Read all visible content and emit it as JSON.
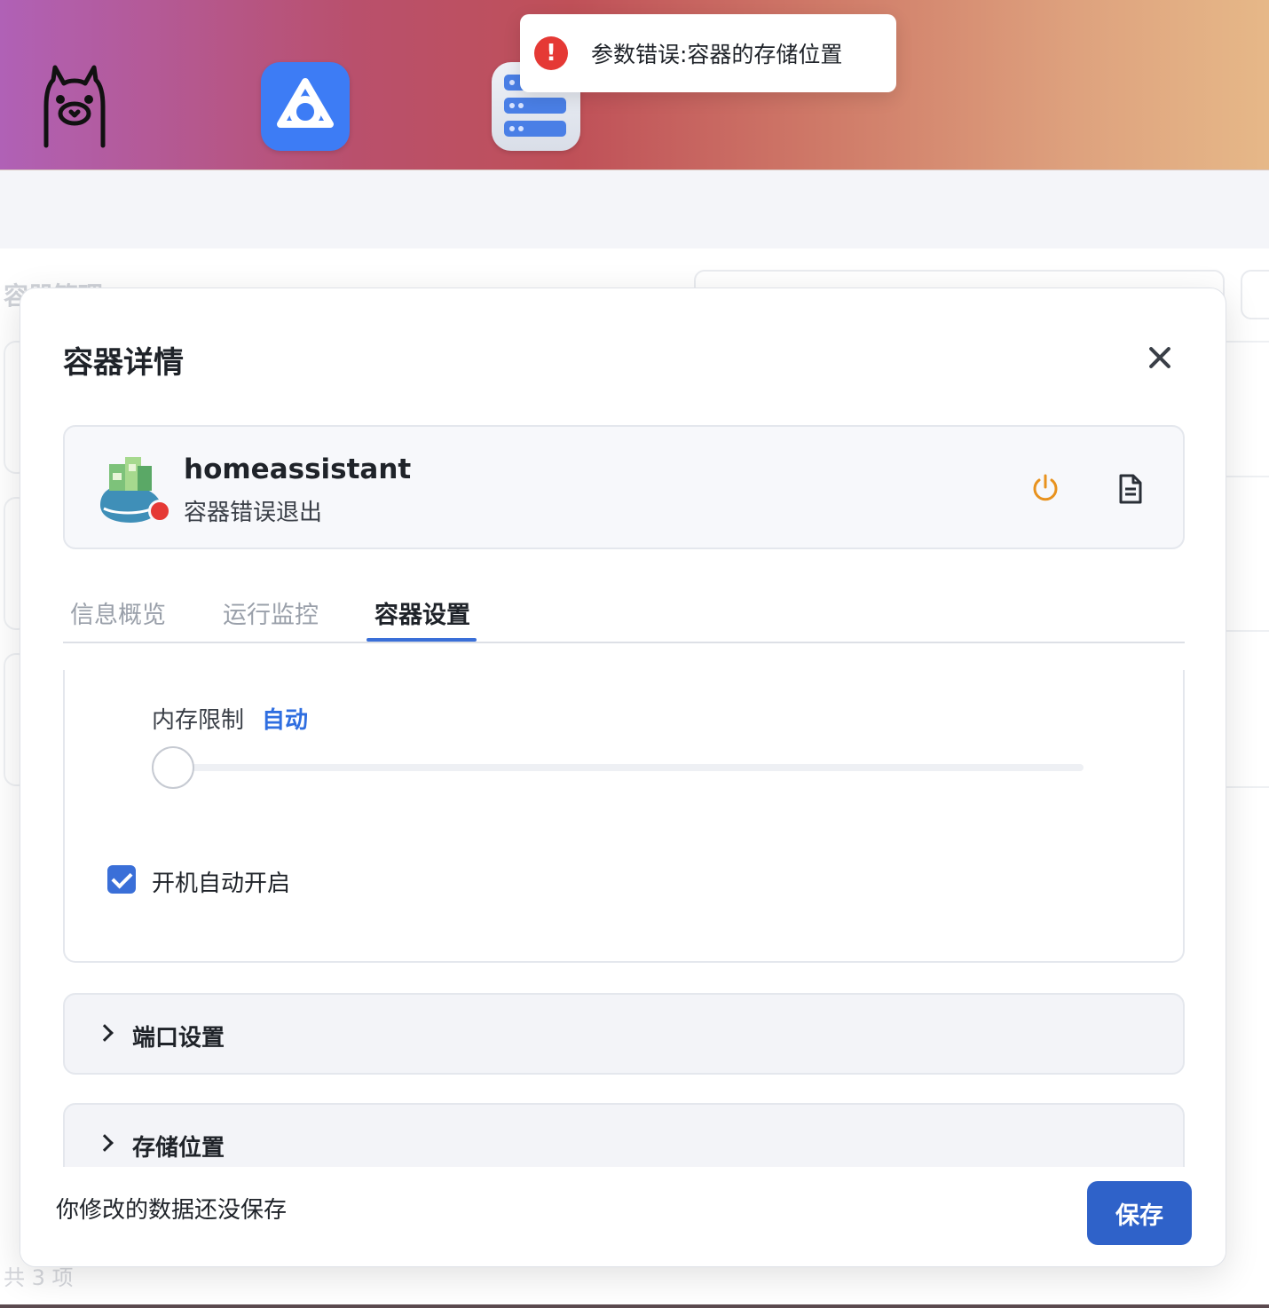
{
  "toast": {
    "icon": "error-exclamation-icon",
    "message": "参数错误:容器的存储位置",
    "color": "#e53935"
  },
  "dock": {
    "items": [
      "llama-app-icon",
      "blue-triangle-app-icon",
      "server-app-icon"
    ]
  },
  "background_page": {
    "title": "容器管理",
    "count": "共 3 项"
  },
  "dialog": {
    "title": "容器详情",
    "container": {
      "name": "homeassistant",
      "status": "容器错误退出",
      "status_color": "#e53935"
    },
    "tabs": [
      {
        "label": "信息概览",
        "active": false
      },
      {
        "label": "运行监控",
        "active": false
      },
      {
        "label": "容器设置",
        "active": true
      }
    ],
    "settings": {
      "memory_limit_label": "内存限制",
      "memory_limit_value": "自动",
      "memory_slider_fraction": 0,
      "autostart_label": "开机自动开启",
      "autostart_checked": true
    },
    "sections": [
      {
        "label": "端口设置"
      },
      {
        "label": "存储位置"
      }
    ],
    "footer": {
      "unsaved_text": "你修改的数据还没保存",
      "save_label": "保存"
    },
    "accent_color": "#3a6fd8",
    "power_color": "#e8921e"
  }
}
